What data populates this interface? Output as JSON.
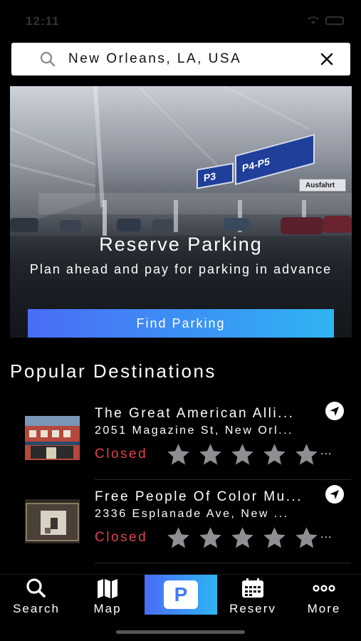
{
  "status_bar": {
    "time": "12:11"
  },
  "search": {
    "value": "New Orleans, LA, USA",
    "icon": "search-icon",
    "clear_icon": "close-icon"
  },
  "hero": {
    "title": "Reserve Parking",
    "subtitle": "Plan ahead and pay for parking in advance",
    "button_label": "Find Parking",
    "sign_left": "P3",
    "sign_right": "P4-P5",
    "sign_exit": "Ausfahrt"
  },
  "section_title": "Popular Destinations",
  "destinations": [
    {
      "name": "The Great American Alli...",
      "address": "2051 Magazine St, New Orl...",
      "status": "Closed",
      "rating_stars": 5,
      "more": "..."
    },
    {
      "name": "Free People Of Color Mu...",
      "address": "2336 Esplanade Ave, New ...",
      "status": "Closed",
      "rating_stars": 5,
      "more": "..."
    }
  ],
  "tabs": [
    {
      "label": "Search",
      "icon": "search-icon"
    },
    {
      "label": "Map",
      "icon": "map-icon"
    },
    {
      "label": "P",
      "icon": "parking-icon"
    },
    {
      "label": "Reserv",
      "icon": "calendar-icon"
    },
    {
      "label": "More",
      "icon": "more-dots-icon"
    }
  ],
  "colors": {
    "accent_start": "#4a6cf7",
    "accent_end": "#2fb4f2",
    "status_closed": "#e0404e",
    "star": "#8e8e93"
  }
}
